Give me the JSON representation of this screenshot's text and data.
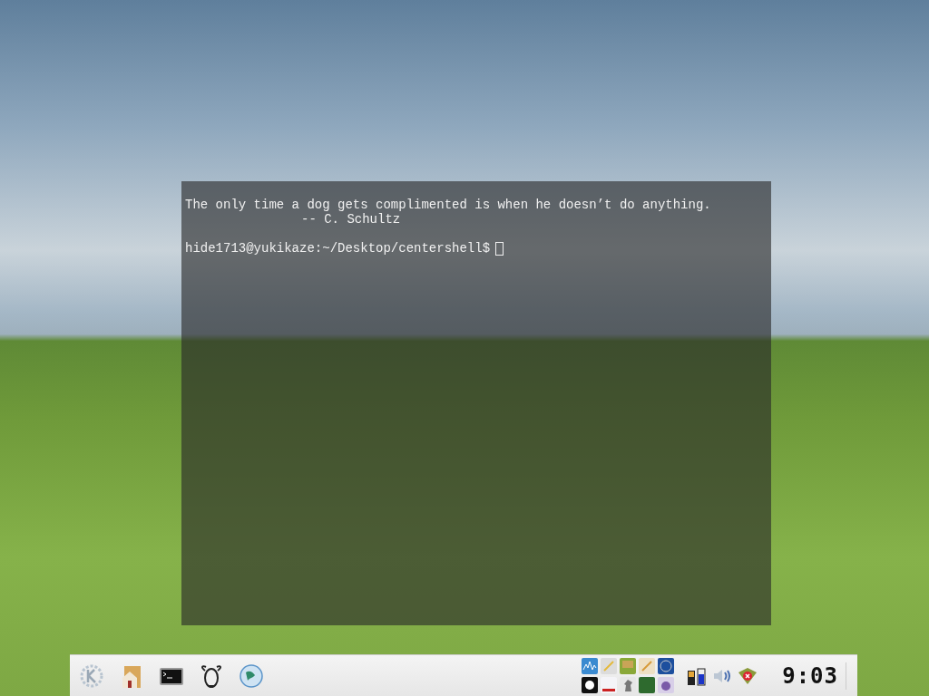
{
  "terminal": {
    "lines": [
      {
        "kind": "output",
        "text": "The only time a dog gets complimented is when he doesn’t do anything."
      },
      {
        "kind": "attribution",
        "text": "-- C. Schultz"
      },
      {
        "kind": "prompt",
        "text": "hide1713@yukikaze:~/Desktop/centershell$"
      }
    ]
  },
  "taskbar": {
    "clock": "9:03"
  }
}
